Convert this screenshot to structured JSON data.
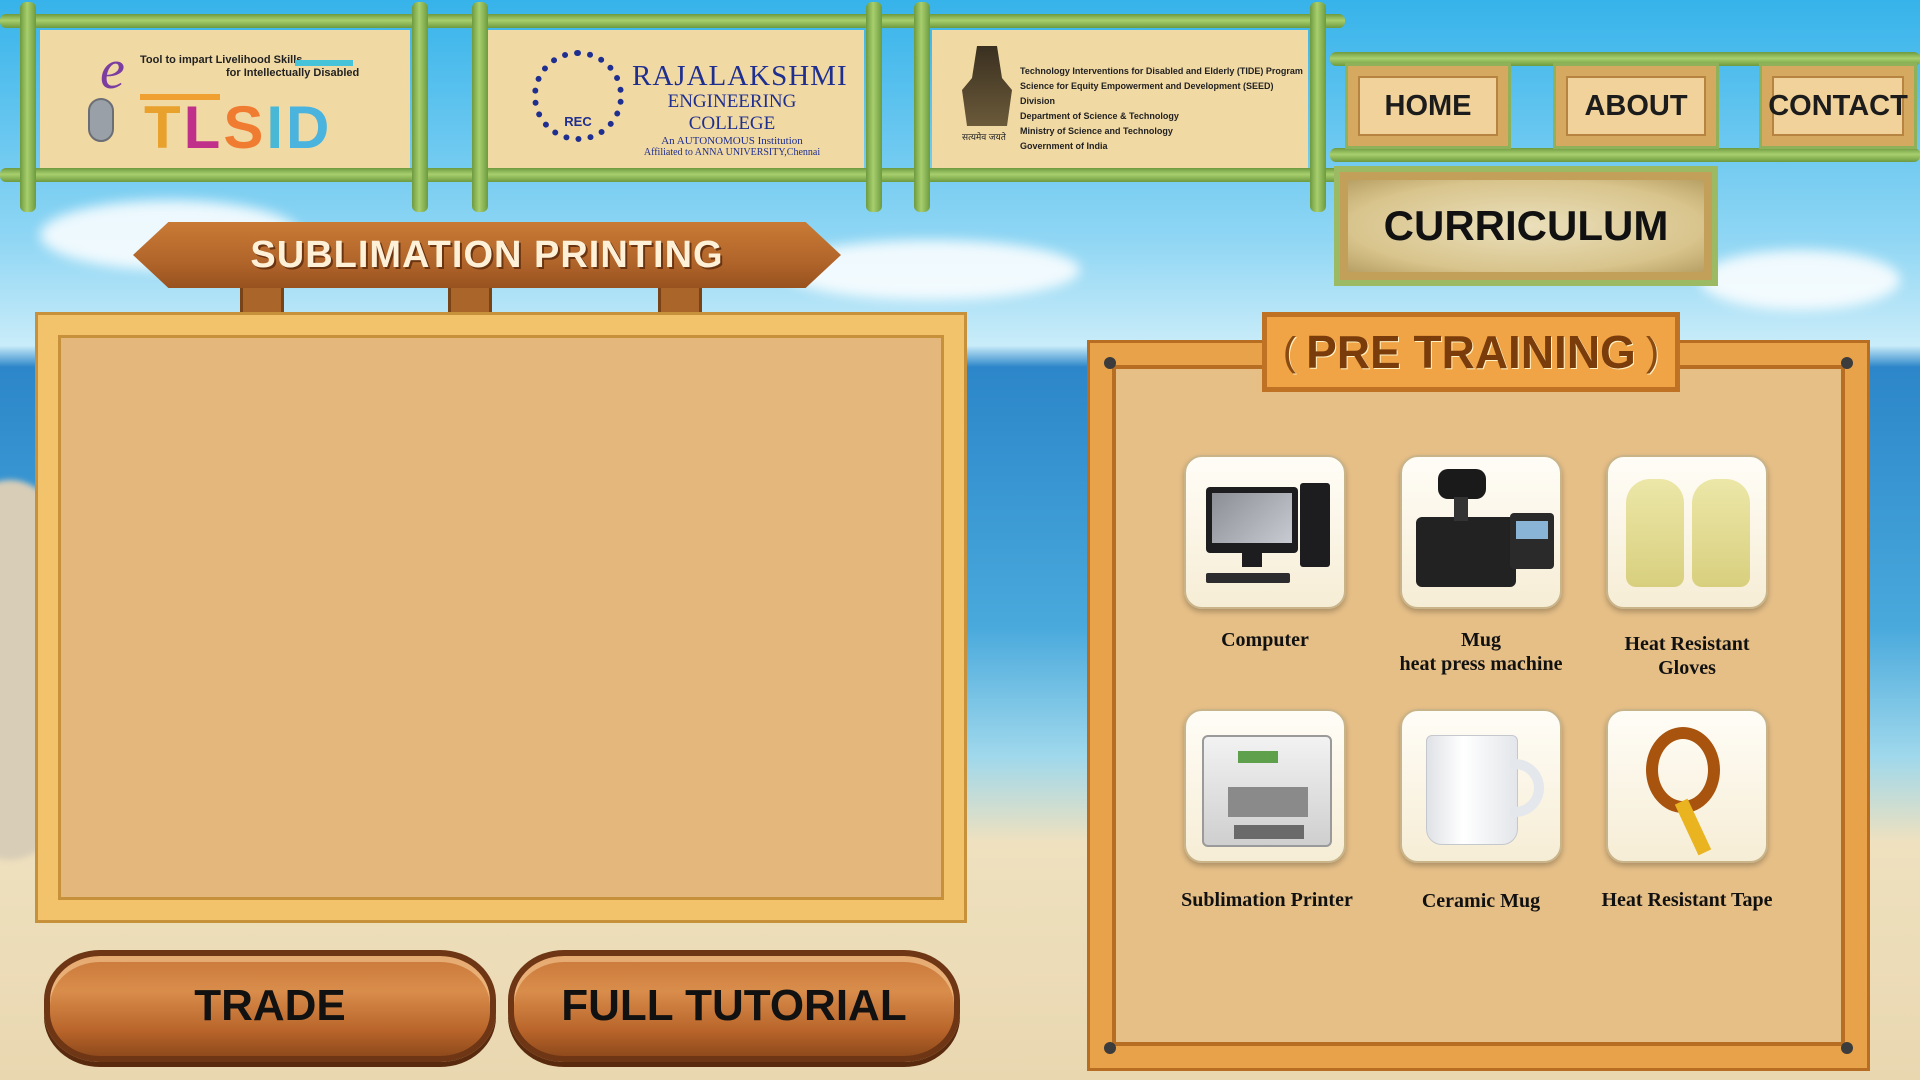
{
  "header": {
    "tlsid": {
      "tagline_1": "Tool to impart Livelihood Skills",
      "tagline_2": "for Intellectually Disabled",
      "e_letter": "e",
      "name": "TLSID"
    },
    "rec": {
      "name": "RAJALAKSHMI",
      "line2": "ENGINEERING COLLEGE",
      "line3": "An AUTONOMOUS Institution",
      "line4": "Affiliated to ANNA UNIVERSITY,Chennai",
      "emblem_text": "REC"
    },
    "govt": {
      "lines": [
        "Technology Interventions for Disabled and Elderly (TIDE) Program",
        "Science for Equity Empowerment and Development (SEED) Division",
        "Department of Science & Technology",
        "Ministry of Science and Technology",
        "Government of India"
      ],
      "emblem_caption": "सत्यमेव जयते"
    }
  },
  "nav": {
    "home": "HOME",
    "about": "ABOUT",
    "contact": "CONTACT",
    "curriculum": "CURRICULUM"
  },
  "sign": {
    "title": "SUBLIMATION PRINTING"
  },
  "buttons": {
    "trade": "TRADE",
    "full_tutorial": "FULL TUTORIAL"
  },
  "pre_training": {
    "title": "PRE TRAINING",
    "items": [
      {
        "line1": "Computer",
        "line2": "",
        "icon": "computer-icon"
      },
      {
        "line1": "Mug",
        "line2": "heat press machine",
        "icon": "heat-press-icon"
      },
      {
        "line1": "Heat Resistant",
        "line2": "Gloves",
        "icon": "gloves-icon"
      },
      {
        "line1": "Sublimation Printer",
        "line2": "",
        "icon": "printer-icon"
      },
      {
        "line1": "Ceramic Mug",
        "line2": "",
        "icon": "mug-icon"
      },
      {
        "line1": "Heat Resistant Tape",
        "line2": "",
        "icon": "tape-icon"
      }
    ]
  },
  "colors": {
    "bamboo_green": "#8ab85a",
    "wood_brown": "#b8642a",
    "board_tan": "#e4b87c",
    "sky_blue": "#36b3ea"
  }
}
